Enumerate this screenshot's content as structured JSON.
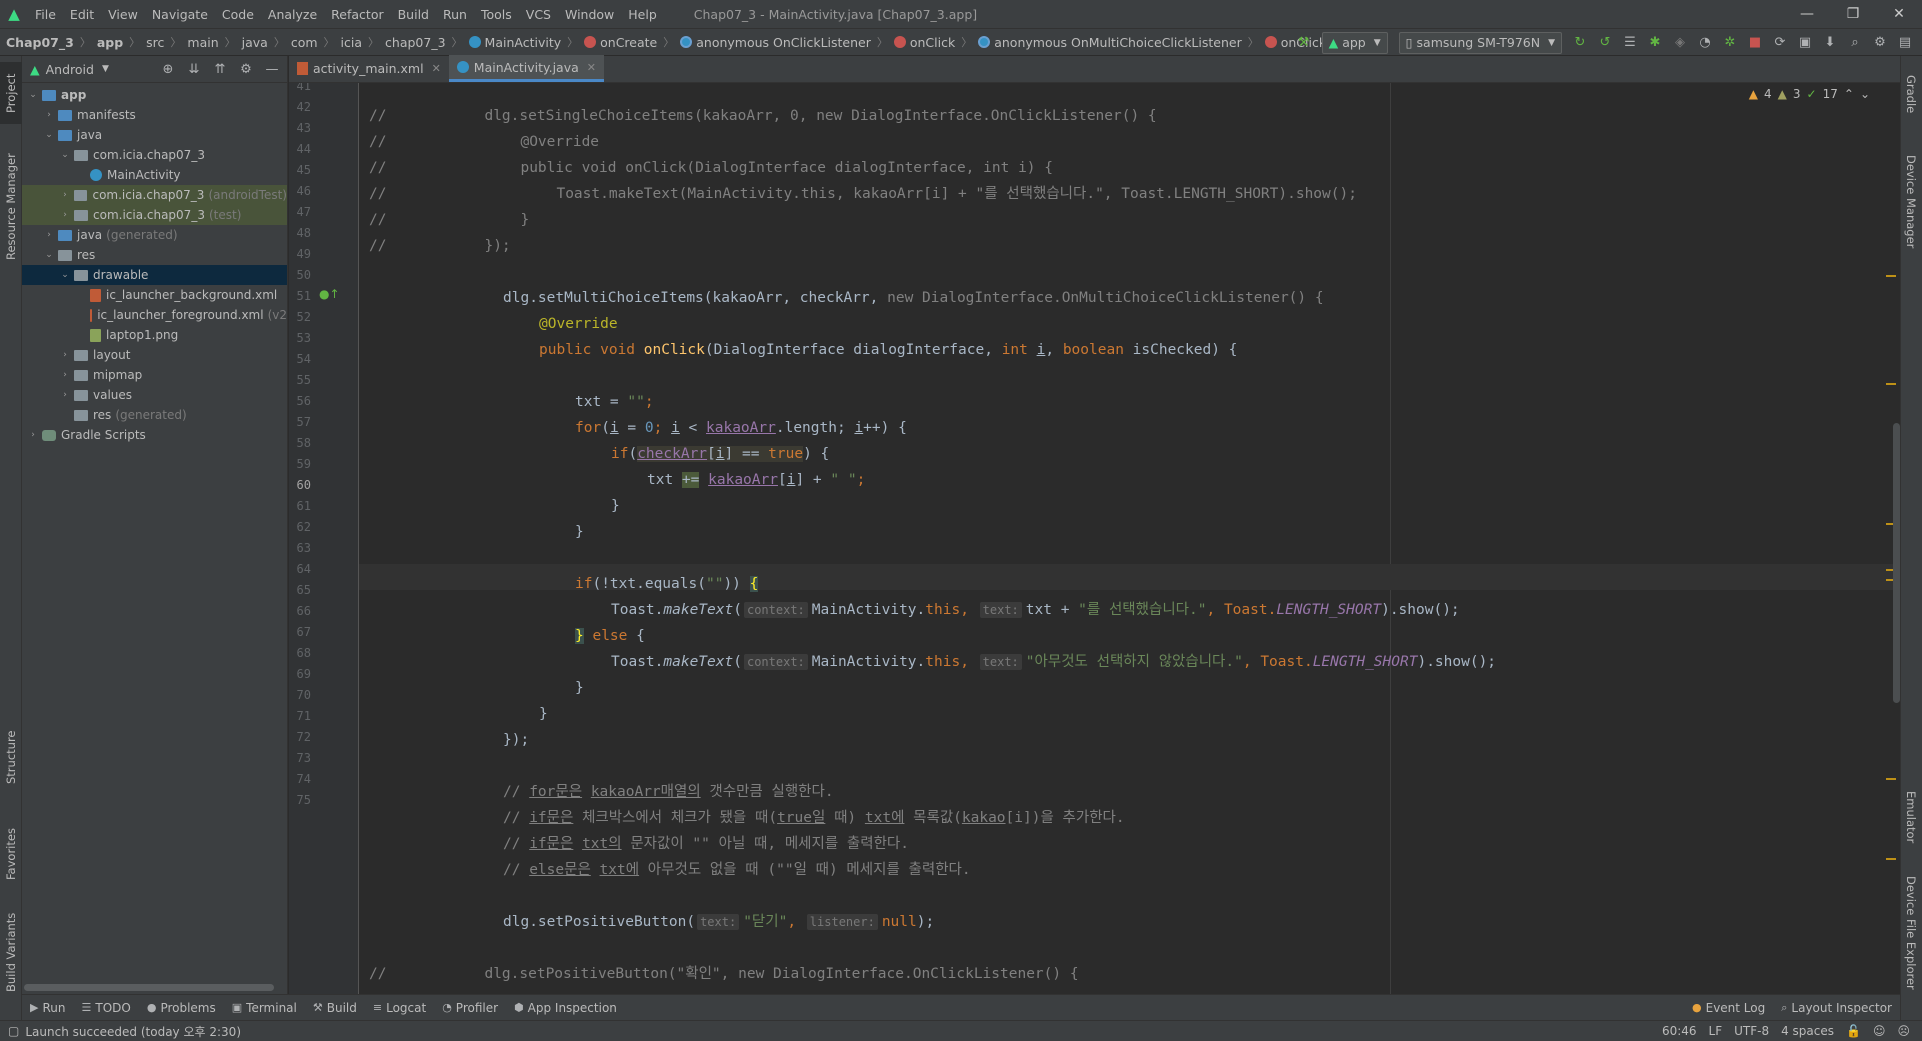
{
  "menubar": {
    "items": [
      "File",
      "Edit",
      "View",
      "Navigate",
      "Code",
      "Analyze",
      "Refactor",
      "Build",
      "Run",
      "Tools",
      "VCS",
      "Window",
      "Help"
    ],
    "title": "Chap07_3 - MainActivity.java [Chap07_3.app]"
  },
  "breadcrumb": [
    "Chap07_3",
    "app",
    "src",
    "main",
    "java",
    "com",
    "icia",
    "chap07_3",
    "MainActivity",
    "onCreate",
    "anonymous OnClickListener",
    "onClick",
    "anonymous OnMultiChoiceClickListener",
    "onClick"
  ],
  "toolbar": {
    "run_config": "app",
    "device": "samsung SM-T976N"
  },
  "left_tool_tabs": [
    "Project",
    "Resource Manager",
    "Structure",
    "Favorites",
    "Build Variants"
  ],
  "right_tool_tabs": [
    "Gradle",
    "Device Manager",
    "Emulator",
    "Device File Explorer"
  ],
  "project": {
    "view_mode": "Android",
    "tree": [
      {
        "label": "app",
        "icon": "module"
      },
      {
        "label": "manifests",
        "icon": "folder"
      },
      {
        "label": "java",
        "icon": "folder"
      },
      {
        "label": "com.icia.chap07_3",
        "icon": "package"
      },
      {
        "label": "MainActivity",
        "icon": "class"
      },
      {
        "label": "com.icia.chap07_3",
        "suffix": "(androidTest)",
        "icon": "package"
      },
      {
        "label": "com.icia.chap07_3",
        "suffix": "(test)",
        "icon": "package"
      },
      {
        "label": "java",
        "suffix": "(generated)",
        "icon": "folder"
      },
      {
        "label": "res",
        "icon": "folder"
      },
      {
        "label": "drawable",
        "icon": "folder"
      },
      {
        "label": "ic_launcher_background.xml",
        "icon": "xml"
      },
      {
        "label": "ic_launcher_foreground.xml",
        "suffix": "(v2",
        "icon": "xml"
      },
      {
        "label": "laptop1.png",
        "icon": "png"
      },
      {
        "label": "layout",
        "icon": "folder"
      },
      {
        "label": "mipmap",
        "icon": "folder"
      },
      {
        "label": "values",
        "icon": "folder"
      },
      {
        "label": "res",
        "suffix": "(generated)",
        "icon": "folder"
      },
      {
        "label": "Gradle Scripts",
        "icon": "gradle"
      }
    ]
  },
  "editor_tabs": [
    {
      "label": "activity_main.xml"
    },
    {
      "label": "MainActivity.java"
    }
  ],
  "inspection": {
    "warnings": "4",
    "weak_warnings": "3",
    "ok": "17"
  },
  "line_numbers": [
    "41",
    "42",
    "43",
    "44",
    "45",
    "46",
    "47",
    "48",
    "49",
    "50",
    "51",
    "52",
    "53",
    "54",
    "55",
    "56",
    "57",
    "58",
    "59",
    "60",
    "61",
    "62",
    "63",
    "64",
    "65",
    "66",
    "67",
    "68",
    "69",
    "70",
    "71",
    "72",
    "73",
    "74",
    "75"
  ],
  "code": {
    "l42": {
      "c": "//",
      "t": "dlg.setSingleChoiceItems(kakaoArr, 0, new DialogInterface.OnClickListener() {"
    },
    "l43": {
      "c": "//",
      "t": "@Override"
    },
    "l44": {
      "c": "//",
      "t": "public void onClick(DialogInterface dialogInterface, int i) {"
    },
    "l45": {
      "c": "//",
      "t": "Toast.makeText(MainActivity.this, kakaoArr[i] + \"를 선택했습니다.\", Toast.LENGTH_SHORT).show();"
    },
    "l46": {
      "c": "//",
      "t": "}"
    },
    "l47": {
      "c": "//",
      "t": "});"
    },
    "l49": {
      "a": "dlg.setMultiChoiceItems(kakaoArr, checkArr, ",
      "b": "new DialogInterface.OnMultiChoiceClickListener() {"
    },
    "l50": "@Override",
    "l51": {
      "kw": "public void ",
      "fn": "onClick",
      "rest": "(DialogInterface dialogInterface, ",
      "kw2": "int ",
      "i": "i",
      "comma": ", ",
      "kw3": "boolean ",
      "end": "isChecked) {"
    },
    "l53": {
      "a": "txt = ",
      "s": "\"\"",
      "e": ";"
    },
    "l54": {
      "kw": "for",
      "a": "(",
      "i1": "i",
      "eq": " = ",
      "n": "0",
      "semi": "; ",
      "i2": "i",
      "lt": " < ",
      "arr": "kakaoArr",
      "len": ".length; ",
      "i3": "i",
      "e": "++) {"
    },
    "l55": {
      "kw": "if",
      "a": "(",
      "arr": "checkArr",
      "b": "[",
      "i": "i",
      "c": "] == ",
      "t": "true",
      "e": ") {"
    },
    "l56": {
      "a": "txt ",
      "op": "+=",
      "b": " ",
      "arr": "kakaoArr",
      "c": "[",
      "i": "i",
      "d": "] + ",
      "s": "\" \"",
      "e": ";"
    },
    "l57": "}",
    "l58": "}",
    "l60": {
      "kw": "if",
      "a": "(!txt.equals(",
      "s": "\"\"",
      "e": ")) ",
      "br": "{"
    },
    "l61": {
      "a": "Toast.",
      "m": "makeText",
      "b": "(",
      "h1": "context:",
      "c": "MainActivity.",
      "th": "this",
      "d": ", ",
      "h2": "text:",
      "e": "txt + ",
      "s": "\"를 선택했습니다.\"",
      "f": ", Toast.",
      "ls": "LENGTH_SHORT",
      "g": ").show();"
    },
    "l62": {
      "br": "}",
      "kw": " else ",
      "e": "{"
    },
    "l63": {
      "a": "Toast.",
      "m": "makeText",
      "b": "(",
      "h1": "context:",
      "c": "MainActivity.",
      "th": "this",
      "d": ", ",
      "h2": "text:",
      "s": "\"아무것도 선택하지 않았습니다.\"",
      "f": ", Toast.",
      "ls": "LENGTH_SHORT",
      "g": ").show();"
    },
    "l64": "}",
    "l65": "}",
    "l66": "});",
    "l68": {
      "p": "// ",
      "u1": "for문은",
      "sp": " ",
      "u2": "kakaoArr매열의",
      "r": " 갯수만큼 실행한다."
    },
    "l69": {
      "p": "// ",
      "u1": "if문은",
      "m1": " 체크박스에서 체크가 됐을 때(",
      "u2": "true일",
      "m2": " 때) ",
      "u3": "txt에",
      "m3": " 목록값(",
      "u4": "kakao",
      "r": "[i])을 추가한다."
    },
    "l70": {
      "p": "// ",
      "u1": "if문은",
      "sp": " ",
      "u2": "txt의",
      "r": " 문자값이 \"\" 아닐 때, 메세지를 출력한다."
    },
    "l71": {
      "p": "// ",
      "u1": "else문은",
      "sp": " ",
      "u2": "txt에",
      "r": " 아무것도 없을 때 (\"\"일 때) 메세지를 출력한다."
    },
    "l73": {
      "a": "dlg.setPositiveButton(",
      "h1": "text:",
      "s": "\"닫기\"",
      "b": ", ",
      "h2": "listener:",
      "k": "null",
      "e": ");"
    },
    "l75": {
      "c": "//",
      "t": "dlg.setPositiveButton(\"확인\", new DialogInterface.OnClickListener() {"
    }
  },
  "bottom_tools": [
    "Run",
    "TODO",
    "Problems",
    "Terminal",
    "Build",
    "Logcat",
    "Profiler",
    "App Inspection"
  ],
  "bottom_tools_right": [
    "Event Log",
    "Layout Inspector"
  ],
  "status": {
    "message": "Launch succeeded (today 오후 2:30)",
    "position": "60:46",
    "line_sep": "LF",
    "encoding": "UTF-8",
    "indent": "4 spaces"
  }
}
